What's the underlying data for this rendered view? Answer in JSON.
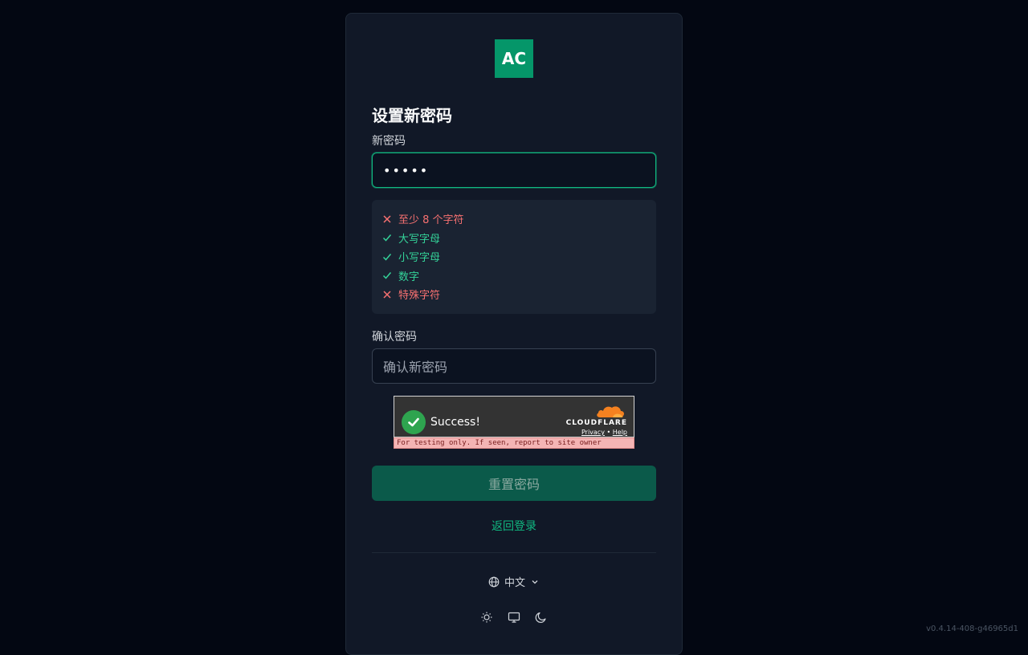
{
  "logo": {
    "text": "AC"
  },
  "form": {
    "title": "设置新密码",
    "new_password_label": "新密码",
    "new_password_value": "•••••",
    "requirements": [
      {
        "label": "至少 8 个字符",
        "met": false
      },
      {
        "label": "大写字母",
        "met": true
      },
      {
        "label": "小写字母",
        "met": true
      },
      {
        "label": "数字",
        "met": true
      },
      {
        "label": "特殊字符",
        "met": false
      }
    ],
    "confirm_label": "确认密码",
    "confirm_placeholder": "确认新密码",
    "submit_label": "重置密码",
    "back_link": "返回登录"
  },
  "captcha": {
    "status": "Success!",
    "brand": "CLOUDFLARE",
    "privacy": "Privacy",
    "separator": "•",
    "help": "Help",
    "note": "For testing only. If seen, report to site owner"
  },
  "footer": {
    "language": "中文",
    "version": "v0.4.14-408-g46965d1"
  },
  "colors": {
    "accent": "#10b981",
    "fail": "#f87171",
    "pass": "#34d399"
  }
}
